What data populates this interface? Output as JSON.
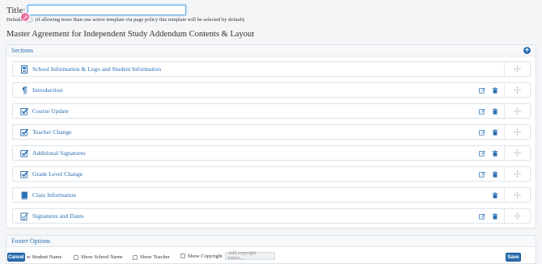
{
  "title_field": {
    "label": "Title:",
    "value": ""
  },
  "default_option": {
    "prefix": "Default",
    "note": "(if allowing more than one active template via page policy this template will be selected by default)"
  },
  "page_heading": "Master Agreement for Independent Study Addendum Contents & Layout",
  "sections_panel": {
    "title": "Sections",
    "items": [
      {
        "label": "School Information & Logo and Student Information",
        "icon": "document-icon",
        "editable": false,
        "deletable": false
      },
      {
        "label": "Introduction",
        "icon": "paragraph-icon",
        "editable": true,
        "deletable": true
      },
      {
        "label": "Course Update",
        "icon": "checkbox-checked-icon",
        "editable": true,
        "deletable": true
      },
      {
        "label": "Teacher Change",
        "icon": "checkbox-checked-icon",
        "editable": true,
        "deletable": true
      },
      {
        "label": "Additional Signatures",
        "icon": "checkbox-checked-icon",
        "editable": true,
        "deletable": true
      },
      {
        "label": "Grade Level Change",
        "icon": "checkbox-checked-icon",
        "editable": true,
        "deletable": true
      },
      {
        "label": "Class Information",
        "icon": "book-icon",
        "editable": false,
        "deletable": true
      },
      {
        "label": "Signatures and Dates",
        "icon": "signature-icon",
        "editable": true,
        "deletable": true
      }
    ]
  },
  "footer_panel": {
    "title": "Footer Options",
    "show_student_name": "w Student Name",
    "show_school_name": "Show School Name",
    "show_teacher": "Show Teacher",
    "show_copyright": "Show Copyright",
    "copyright_placeholder": "Add copyright notice..."
  },
  "buttons": {
    "cancel": "Cancel",
    "save": "Save"
  },
  "colors": {
    "accent": "#2a6fb0",
    "badge": "#e66b9f"
  }
}
